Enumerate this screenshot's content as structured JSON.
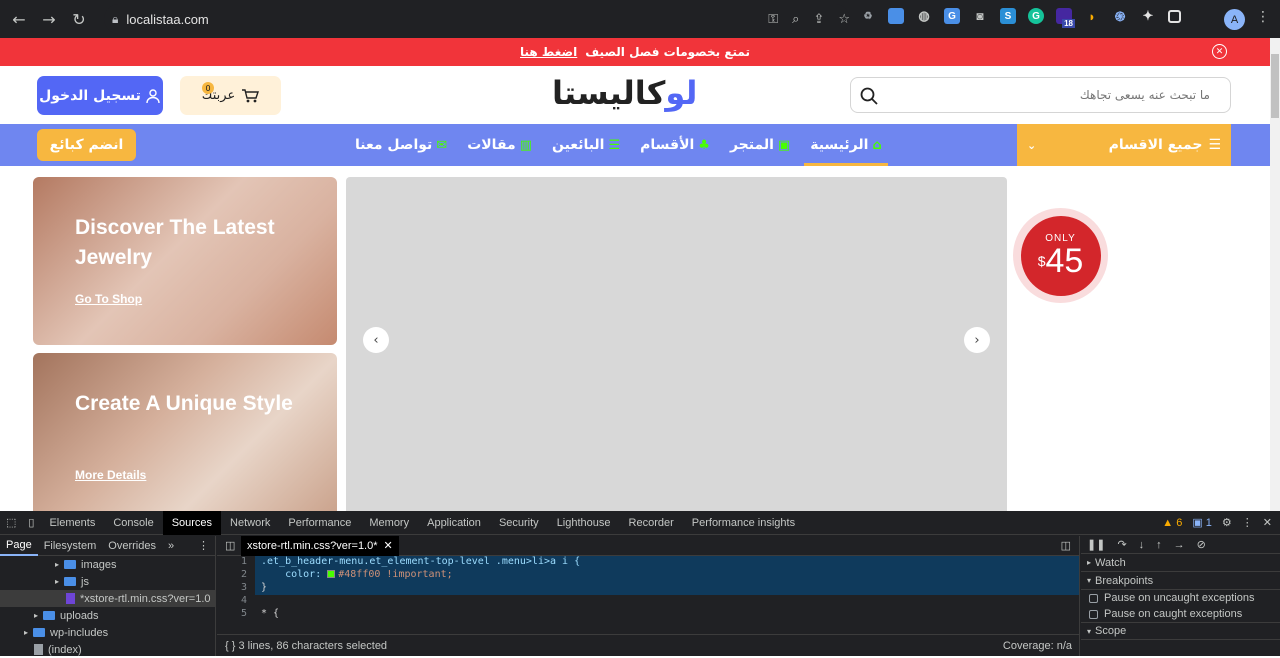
{
  "browser": {
    "url": "localistaa.com",
    "ext_badge": "18",
    "avatar_letter": "A"
  },
  "promo": {
    "text": "تمتع بخصومات فصل الصيف",
    "link": "اضغط هنا"
  },
  "header": {
    "login_label": "تسجيل الدخول",
    "cart_label": "عربتك",
    "cart_count": "0",
    "logo_text": "لوكاليستا",
    "search_placeholder": "ما تبحث عنه يسعى تجاهك"
  },
  "menu": {
    "join_label": "انضم كبائع",
    "categories_label": "جميع الاقسام",
    "items": [
      {
        "label": "الرئيسية",
        "icon": "home-icon"
      },
      {
        "label": "المتجر",
        "icon": "store-icon"
      },
      {
        "label": "الأقسام",
        "icon": "categories-icon"
      },
      {
        "label": "البائعين",
        "icon": "list-icon"
      },
      {
        "label": "مقالات",
        "icon": "articles-icon"
      },
      {
        "label": "تواصل معنا",
        "icon": "mail-icon"
      }
    ]
  },
  "banners": [
    {
      "title": "Discover The Latest Jewelry",
      "link": "Go To Shop"
    },
    {
      "title": "Create A Unique Style",
      "link": "More Details"
    }
  ],
  "price_badge": {
    "only": "ONLY",
    "currency": "$",
    "amount": "45"
  },
  "devtools": {
    "tabs": [
      "Elements",
      "Console",
      "Sources",
      "Network",
      "Performance",
      "Memory",
      "Application",
      "Security",
      "Lighthouse",
      "Recorder",
      "Performance insights"
    ],
    "active_tab": "Sources",
    "warnings": "6",
    "messages": "1",
    "subtabs": [
      "Page",
      "Filesystem",
      "Overrides"
    ],
    "tree": [
      "images",
      "js",
      "*xstore-rtl.min.css?ver=1.0",
      "uploads",
      "wp-includes",
      "(index)"
    ],
    "file_tab": "xstore-rtl.min.css?ver=1.0*",
    "code": [
      {
        "n": "1",
        "text": ".et_b_header-menu.et_element-top-level .menu>li>a i {"
      },
      {
        "n": "2",
        "prop": "color:",
        "val": "#48ff00 !important;"
      },
      {
        "n": "3",
        "text": "}"
      },
      {
        "n": "4",
        "text": ""
      },
      {
        "n": "5",
        "text": "* {"
      }
    ],
    "status_left": "3 lines, 86 characters selected",
    "status_right": "Coverage: n/a",
    "right_panel": {
      "watch": "Watch",
      "breakpoints": "Breakpoints",
      "pause_uncaught": "Pause on uncaught exceptions",
      "pause_caught": "Pause on caught exceptions",
      "scope": "Scope"
    }
  }
}
